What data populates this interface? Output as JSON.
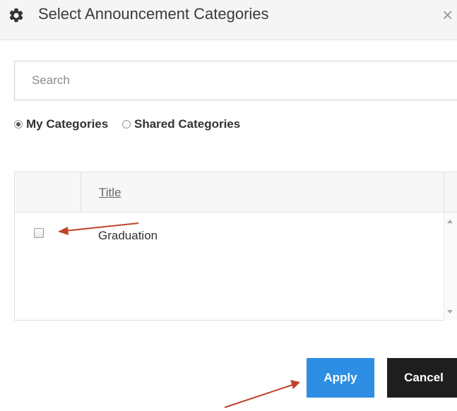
{
  "dialog": {
    "title": "Select Announcement Categories",
    "close_symbol": "×",
    "icon": "gear-icon"
  },
  "search": {
    "placeholder": "Search",
    "value": ""
  },
  "filter": {
    "options": [
      {
        "label": "My Categories",
        "checked": true
      },
      {
        "label": "Shared Categories",
        "checked": false
      }
    ]
  },
  "table": {
    "columns": [
      "",
      "Title"
    ],
    "rows": [
      {
        "title": "Graduation",
        "checked": false
      }
    ]
  },
  "buttons": {
    "apply": "Apply",
    "cancel": "Cancel"
  },
  "colors": {
    "apply_bg": "#2d8ee3",
    "cancel_bg": "#1e1e1e",
    "annotation_arrow": "#c0432b"
  }
}
